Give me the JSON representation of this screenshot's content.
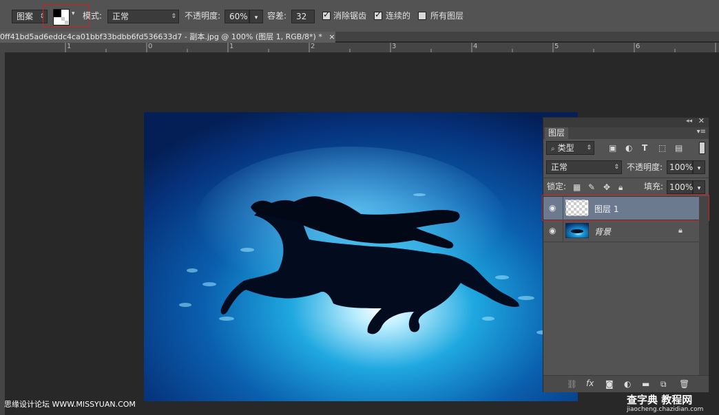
{
  "options_bar": {
    "pattern_dropdown": "图案",
    "mode_label": "模式:",
    "mode_value": "正常",
    "opacity_label": "不透明度:",
    "opacity_value": "60%",
    "tolerance_label": "容差:",
    "tolerance_value": "32",
    "antialias_label": "消除锯齿",
    "contiguous_label": "连续的",
    "all_layers_label": "所有图层"
  },
  "document_tab": {
    "title": "0ff41bd5ad6eddc4ca01bbf33bdbb6fd536633d7 - 副本.jpg @ 100% (图层 1, RGB/8*) *",
    "close": "×"
  },
  "ruler": {
    "ticks": [
      "1",
      "0",
      "1",
      "2",
      "3",
      "4",
      "5",
      "6"
    ]
  },
  "layers_panel": {
    "tab_title": "图层",
    "filter_kind": "类型",
    "blend_mode": "正常",
    "opacity_label": "不透明度:",
    "opacity_value": "100%",
    "lock_label": "锁定:",
    "fill_label": "填充:",
    "fill_value": "100%",
    "layers": [
      {
        "name": "图层 1",
        "selected": true
      },
      {
        "name": "背景",
        "locked": true
      }
    ]
  },
  "watermarks": {
    "left": "思缘设计论坛 WWW.MISSYUAN.COM",
    "right_main": "查字典 教程网",
    "right_sub": "jiaocheng.chazidian.com"
  },
  "colors": {
    "ui_dark": "#535353",
    "selection_highlight": "#cc2222",
    "selected_layer": "#6b7a8f"
  }
}
